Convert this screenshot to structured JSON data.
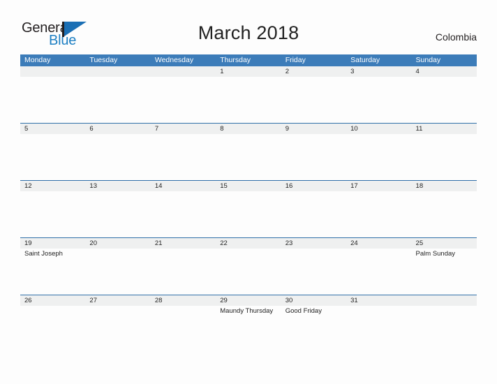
{
  "brand": {
    "name_part1": "General",
    "name_part2": "Blue",
    "mark": "flag-triangle",
    "color_dark": "#231f20",
    "color_blue": "#1b6fb4"
  },
  "header": {
    "title": "March 2018",
    "region": "Colombia"
  },
  "theme": {
    "header_blue": "#3c7cb9",
    "separator_blue": "#2f6fa8",
    "date_band": "#eff0f0",
    "page_background": "#fdfdfd",
    "text": "#222222"
  },
  "calendar": {
    "weekdays": [
      "Monday",
      "Tuesday",
      "Wednesday",
      "Thursday",
      "Friday",
      "Saturday",
      "Sunday"
    ],
    "weeks": [
      {
        "days": [
          {
            "date": "",
            "event": ""
          },
          {
            "date": "",
            "event": ""
          },
          {
            "date": "",
            "event": ""
          },
          {
            "date": "1",
            "event": ""
          },
          {
            "date": "2",
            "event": ""
          },
          {
            "date": "3",
            "event": ""
          },
          {
            "date": "4",
            "event": ""
          }
        ]
      },
      {
        "days": [
          {
            "date": "5",
            "event": ""
          },
          {
            "date": "6",
            "event": ""
          },
          {
            "date": "7",
            "event": ""
          },
          {
            "date": "8",
            "event": ""
          },
          {
            "date": "9",
            "event": ""
          },
          {
            "date": "10",
            "event": ""
          },
          {
            "date": "11",
            "event": ""
          }
        ]
      },
      {
        "days": [
          {
            "date": "12",
            "event": ""
          },
          {
            "date": "13",
            "event": ""
          },
          {
            "date": "14",
            "event": ""
          },
          {
            "date": "15",
            "event": ""
          },
          {
            "date": "16",
            "event": ""
          },
          {
            "date": "17",
            "event": ""
          },
          {
            "date": "18",
            "event": ""
          }
        ]
      },
      {
        "days": [
          {
            "date": "19",
            "event": "Saint Joseph"
          },
          {
            "date": "20",
            "event": ""
          },
          {
            "date": "21",
            "event": ""
          },
          {
            "date": "22",
            "event": ""
          },
          {
            "date": "23",
            "event": ""
          },
          {
            "date": "24",
            "event": ""
          },
          {
            "date": "25",
            "event": "Palm Sunday"
          }
        ]
      },
      {
        "days": [
          {
            "date": "26",
            "event": ""
          },
          {
            "date": "27",
            "event": ""
          },
          {
            "date": "28",
            "event": ""
          },
          {
            "date": "29",
            "event": "Maundy Thursday"
          },
          {
            "date": "30",
            "event": "Good Friday"
          },
          {
            "date": "31",
            "event": ""
          },
          {
            "date": "",
            "event": ""
          }
        ]
      }
    ]
  }
}
